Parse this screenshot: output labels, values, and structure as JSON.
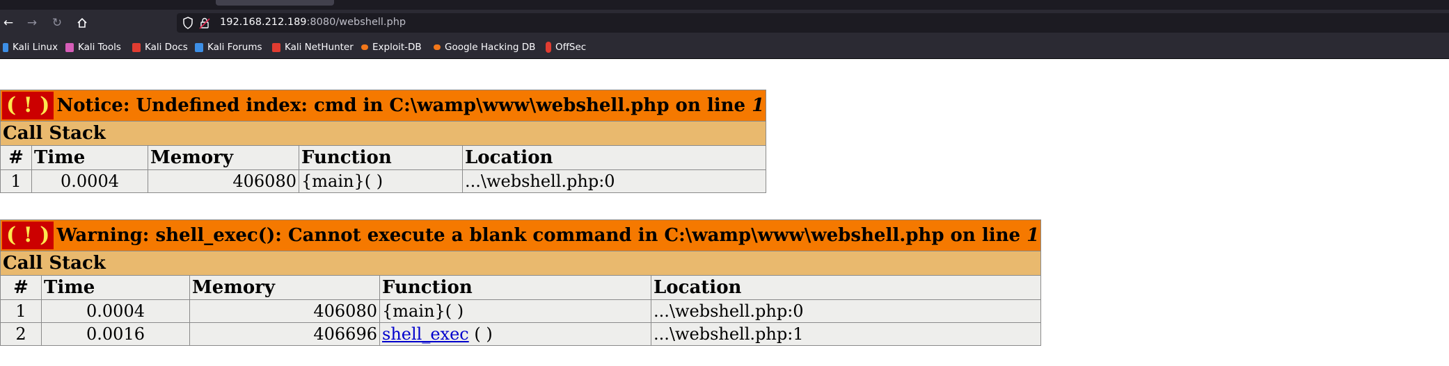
{
  "browser": {
    "url_host": "192.168.212.189",
    "url_rest": ":8080/webshell.php",
    "bookmarks": [
      {
        "label": "Kali Linux",
        "icon": "kali-dragon-icon",
        "color": "#3d8fe6"
      },
      {
        "label": "Kali Tools",
        "icon": "kali-tools-icon",
        "color": "#d65db8"
      },
      {
        "label": "Kali Docs",
        "icon": "kali-docs-icon",
        "color": "#e03c31"
      },
      {
        "label": "Kali Forums",
        "icon": "kali-forums-icon",
        "color": "#3d8fe6"
      },
      {
        "label": "Kali NetHunter",
        "icon": "kali-nethunter-icon",
        "color": "#e03c31"
      },
      {
        "label": "Exploit-DB",
        "icon": "exploit-db-icon",
        "color": "#f2771a"
      },
      {
        "label": "Google Hacking DB",
        "icon": "ghdb-icon",
        "color": "#f2771a"
      },
      {
        "label": "OffSec",
        "icon": "offsec-icon",
        "color": "#e03c31"
      }
    ]
  },
  "errors": [
    {
      "bang": "( ! )",
      "message": "Notice: Undefined index: cmd in C:\\wamp\\www\\webshell.php on line ",
      "line": "1",
      "stack_title": "Call Stack",
      "columns": [
        "#",
        "Time",
        "Memory",
        "Function",
        "Location"
      ],
      "rows": [
        {
          "num": "1",
          "time": "0.0004",
          "memory": "406080",
          "func": "{main}( )",
          "func_link": "",
          "func_suffix": "",
          "location": "...\\webshell.php:0"
        }
      ]
    },
    {
      "bang": "( ! )",
      "message": "Warning: shell_exec(): Cannot execute a blank command in C:\\wamp\\www\\webshell.php on line ",
      "line": "1",
      "stack_title": "Call Stack",
      "columns": [
        "#",
        "Time",
        "Memory",
        "Function",
        "Location"
      ],
      "rows": [
        {
          "num": "1",
          "time": "0.0004",
          "memory": "406080",
          "func": "{main}( )",
          "func_link": "",
          "func_suffix": "",
          "location": "...\\webshell.php:0"
        },
        {
          "num": "2",
          "time": "0.0016",
          "memory": "406696",
          "func": "",
          "func_link": "shell_exec",
          "func_suffix": " ( )",
          "location": "...\\webshell.php:1"
        }
      ]
    }
  ]
}
